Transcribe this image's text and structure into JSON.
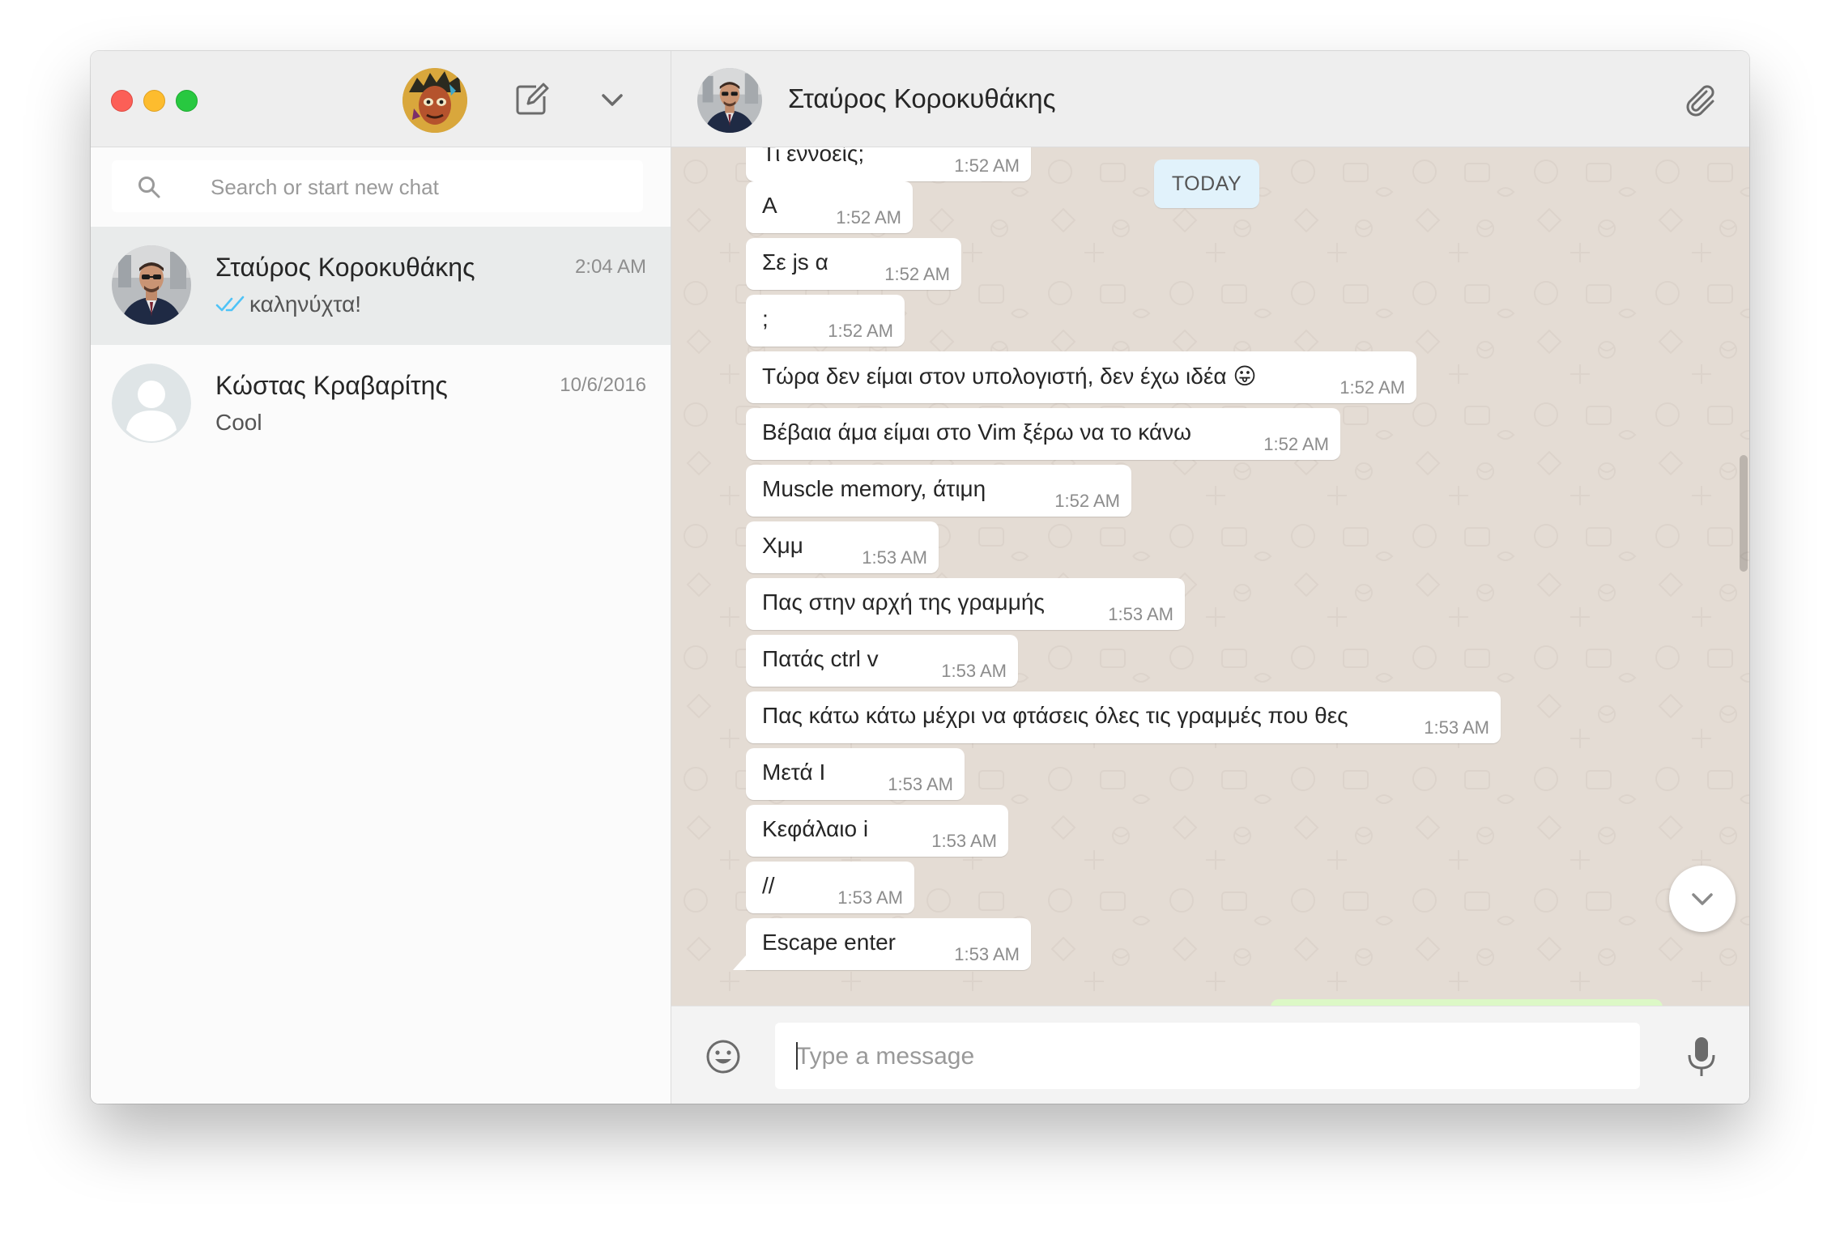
{
  "sidebar": {
    "search": {
      "placeholder": "Search or start new chat",
      "value": ""
    },
    "chats": [
      {
        "name": "Σταύρος Κοροκυθάκης",
        "time": "2:04 AM",
        "preview": "καληνύχτα!",
        "status": "read",
        "active": true
      },
      {
        "name": "Κώστας Κραβαρίτης",
        "time": "10/6/2016",
        "preview": "Cool",
        "active": false
      }
    ]
  },
  "conversation": {
    "contact_name": "Σταύρος Κοροκυθάκης",
    "date_badge": "TODAY",
    "messages": [
      {
        "text": "Τι εννοείς;",
        "time": "1:52 AM"
      },
      {
        "text": "Α",
        "time": "1:52 AM"
      },
      {
        "text": "Σε js α",
        "time": "1:52 AM"
      },
      {
        "text": ";",
        "time": "1:52 AM"
      },
      {
        "text": "Τώρα δεν είμαι στον υπολογιστή, δεν έχω ιδέα",
        "emoji": "😛",
        "time": "1:52 AM"
      },
      {
        "text": "Βέβαια άμα είμαι στο Vim ξέρω να το κάνω",
        "time": "1:52 AM"
      },
      {
        "text": "Muscle memory, άτιμη",
        "time": "1:52 AM"
      },
      {
        "text": "Χμμ",
        "time": "1:53 AM"
      },
      {
        "text": "Πας στην αρχή της γραμμής",
        "time": "1:53 AM"
      },
      {
        "text": "Πατάς ctrl v",
        "time": "1:53 AM"
      },
      {
        "text": "Πας κάτω κάτω μέχρι να φτάσεις όλες τις γραμμές που θες",
        "time": "1:53 AM"
      },
      {
        "text": "Μετά Ι",
        "time": "1:53 AM"
      },
      {
        "text": "Κεφάλαιο i",
        "time": "1:53 AM"
      },
      {
        "text": "//",
        "time": "1:53 AM"
      },
      {
        "text": "Escape enter",
        "time": "1:53 AM"
      }
    ],
    "composer": {
      "placeholder": "Type a message",
      "value": ""
    }
  },
  "colors": {
    "wallpaper": "#e4dcd4",
    "incoming_bubble": "#ffffff",
    "outgoing_bubble": "#dcf8c6",
    "date_badge": "#e1f2fb",
    "read_ticks": "#4fc3f7",
    "header": "#eeeeee"
  },
  "icons": [
    "compose-icon",
    "chevron-down-icon",
    "search-icon",
    "double-check-icon",
    "paperclip-icon",
    "emoji-icon",
    "microphone-icon"
  ]
}
